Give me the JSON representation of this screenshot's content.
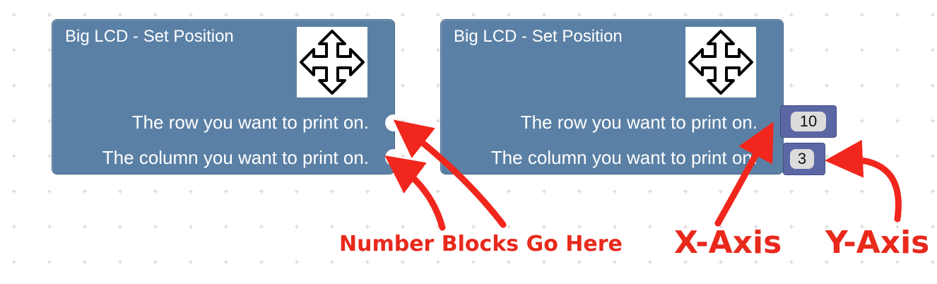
{
  "blocks": [
    {
      "title": "Big LCD - Set Position",
      "icon": "move-arrows-icon",
      "row_label": "The row you want to print on.",
      "column_label": "The column you want to print on."
    },
    {
      "title": "Big LCD - Set Position",
      "icon": "move-arrows-icon",
      "row_label": "The row you want to print on.",
      "column_label": "The column you want to print on.",
      "row_value": "10",
      "column_value": "3"
    }
  ],
  "annotations": {
    "number_blocks": "Number Blocks Go Here",
    "x_axis": "X-Axis",
    "y_axis": "Y-Axis"
  },
  "colors": {
    "block": "#5b80a5",
    "number_block": "#5b67a5",
    "annotation": "#e8291c"
  }
}
